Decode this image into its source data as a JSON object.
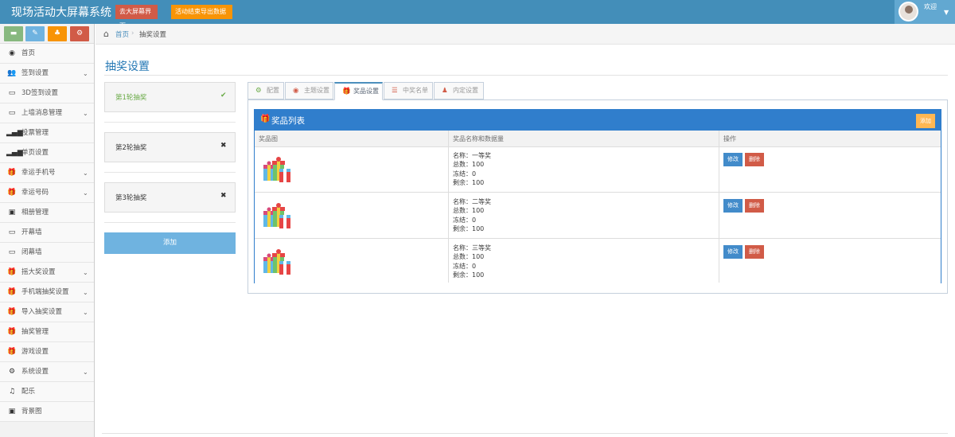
{
  "app": {
    "title": "现场活动大屏幕系统",
    "btn_screen": "去大屏幕界面",
    "btn_export": "活动结束导出数据",
    "welcome": "欢迎"
  },
  "sidebar": {
    "items": [
      {
        "label": "首页",
        "icon": "dashboard-icon",
        "glyph": "◉",
        "caret": false
      },
      {
        "label": "签到设置",
        "icon": "users-icon",
        "glyph": "👥",
        "caret": true
      },
      {
        "label": "3D签到设置",
        "icon": "desktop-icon",
        "glyph": "▭",
        "caret": false
      },
      {
        "label": "上墙消息管理",
        "icon": "desktop-icon",
        "glyph": "▭",
        "caret": true
      },
      {
        "label": "投票管理",
        "icon": "signal-icon",
        "glyph": "▂▄▆",
        "caret": false
      },
      {
        "label": "单页设置",
        "icon": "signal-icon",
        "glyph": "▂▄▆",
        "caret": false
      },
      {
        "label": "幸运手机号",
        "icon": "gift-icon",
        "glyph": "🎁",
        "caret": true
      },
      {
        "label": "幸运号码",
        "icon": "gift-icon",
        "glyph": "🎁",
        "caret": true
      },
      {
        "label": "相册管理",
        "icon": "picture-icon",
        "glyph": "▣",
        "caret": false
      },
      {
        "label": "开幕墙",
        "icon": "desktop-icon",
        "glyph": "▭",
        "caret": false
      },
      {
        "label": "闭幕墙",
        "icon": "desktop-icon",
        "glyph": "▭",
        "caret": false
      },
      {
        "label": "摇大奖设置",
        "icon": "gift-icon",
        "glyph": "🎁",
        "caret": true
      },
      {
        "label": "手机端抽奖设置",
        "icon": "gift-icon",
        "glyph": "🎁",
        "caret": true
      },
      {
        "label": "导入抽奖设置",
        "icon": "gift-icon",
        "glyph": "🎁",
        "caret": true
      },
      {
        "label": "抽奖管理",
        "icon": "gift-icon",
        "glyph": "🎁",
        "caret": false
      },
      {
        "label": "游戏设置",
        "icon": "gift-icon",
        "glyph": "🎁",
        "caret": false
      },
      {
        "label": "系统设置",
        "icon": "gear-icon",
        "glyph": "⚙",
        "caret": true
      },
      {
        "label": "配乐",
        "icon": "music-icon",
        "glyph": "♫",
        "caret": false
      },
      {
        "label": "背景图",
        "icon": "picture-icon",
        "glyph": "▣",
        "caret": false
      }
    ]
  },
  "breadcrumb": {
    "home": "首页",
    "current": "抽奖设置"
  },
  "page": {
    "title": "抽奖设置"
  },
  "rounds": [
    {
      "label": "第1轮抽奖",
      "icon": "check-icon",
      "glyph": "✔",
      "active": true
    },
    {
      "label": "第2轮抽奖",
      "icon": "close-icon",
      "glyph": "✖",
      "active": false
    },
    {
      "label": "第3轮抽奖",
      "icon": "close-icon",
      "glyph": "✖",
      "active": false
    }
  ],
  "add_round_label": "添加",
  "tabs": [
    {
      "label": "配置",
      "icon": "gear-icon",
      "glyph": "⚙",
      "color": "#69aa46",
      "active": false
    },
    {
      "label": "主题设置",
      "icon": "dashboard-icon",
      "glyph": "◉",
      "color": "#d15b47",
      "active": false
    },
    {
      "label": "奖品设置",
      "icon": "gift-icon",
      "glyph": "🎁",
      "color": "#d15b47",
      "active": true
    },
    {
      "label": "中奖名单",
      "icon": "list-icon",
      "glyph": "☰",
      "color": "#d15b47",
      "active": false
    },
    {
      "label": "内定设置",
      "icon": "user-icon",
      "glyph": "♟",
      "color": "#d15b47",
      "active": false
    }
  ],
  "prize_list": {
    "title": "奖品列表",
    "add_label": "添加",
    "headers": {
      "image": "奖品图",
      "name_qty": "奖品名称和数据量",
      "actions": "操作"
    },
    "edit_label": "修改",
    "delete_label": "删除",
    "rows": [
      {
        "name": "名称：一等奖",
        "total": "总数：100",
        "frozen": "冻结：0",
        "remaining": "剩余：100"
      },
      {
        "name": "名称：二等奖",
        "total": "总数：100",
        "frozen": "冻结：0",
        "remaining": "剩余：100"
      },
      {
        "name": "名称：三等奖",
        "total": "总数：100",
        "frozen": "冻结：0",
        "remaining": "剩余：100"
      }
    ]
  },
  "colors": {
    "navbar": "#438eb9",
    "primary": "#307ecc",
    "danger": "#d15b47",
    "warning": "#ffb752",
    "success": "#69aa46"
  }
}
